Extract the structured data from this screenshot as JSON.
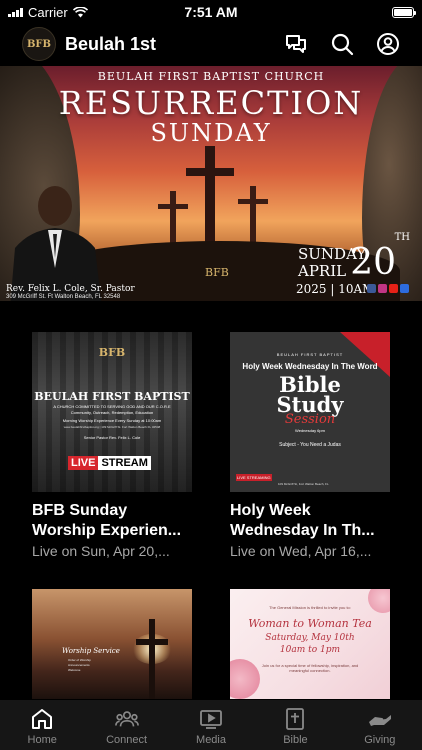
{
  "status_bar": {
    "carrier": "Carrier",
    "time": "7:51 AM"
  },
  "header": {
    "logo_text": "BFB",
    "title": "Beulah 1st"
  },
  "hero": {
    "church": "BEULAH FIRST BAPTIST CHURCH",
    "title_line1": "RESURRECTION",
    "title_line2": "SUNDAY",
    "pastor": "Rev. Felix L. Cole, Sr. Pastor",
    "address": "309 McGriff St. Ft Walton Beach, FL 32548",
    "date_weekday": "SUNDAY",
    "date_month": "APRIL",
    "date_day": "20",
    "date_suffix": "TH",
    "year_time": "2025 | 10AM",
    "watermark": "BFB",
    "slide_count": 5,
    "active_slide": 0
  },
  "cards": [
    {
      "thumb": {
        "logo": "BFB",
        "church": "BEULAH FIRST BAPTIST",
        "tagline": "A CHURCH COMMITTED TO SERVING GOD AND OUR C.O.R.E",
        "pillars": "Community, Outreach, Redemption, Education",
        "service": "Morning Worship Experience Every Sunday at 10:00am",
        "address": "www.beulahfirstbaptist.org | 109 McGriff St. Fort Walton Beach FL 32548",
        "pastor": "Senior Pastor Rev. Felix L. Cole",
        "live_badge_1": "LIVE",
        "live_badge_2": "STREAM"
      },
      "title": "BFB Sunday Worship Experien...",
      "subtitle": "Live on Sun, Apr 20,..."
    },
    {
      "thumb": {
        "header": "BEULAH FIRST BAPTIST",
        "line1": "Holy Week Wednesday In The Word",
        "big1": "Bible",
        "big2": "Study",
        "script": "Session",
        "when": "Wednesday 6pm",
        "subject": "Subject - You Need a Judas",
        "live": "LIVE STREAMING",
        "address": "109 McGriff St, Fort Walton Beach, FL"
      },
      "title": "Holy Week Wednesday In Th...",
      "subtitle": "Live on Wed, Apr 16,..."
    },
    {
      "thumb": {
        "heading": "Worship Service",
        "lines": [
          "Order of Worship",
          "Announcements",
          "Welcome"
        ]
      },
      "title": "",
      "subtitle": ""
    },
    {
      "thumb": {
        "intro": "The General Mission is thrilled to invite you to:",
        "title": "Woman to Woman Tea",
        "date": "Saturday, May 10th",
        "time": "10am to 1pm",
        "body": "Join us for a special time of fellowship, inspiration, and meaningful connection."
      },
      "title": "",
      "subtitle": ""
    }
  ],
  "tabs": [
    {
      "label": "Home",
      "icon": "home-icon",
      "active": true
    },
    {
      "label": "Connect",
      "icon": "people-icon",
      "active": false
    },
    {
      "label": "Media",
      "icon": "play-icon",
      "active": false
    },
    {
      "label": "Bible",
      "icon": "bible-icon",
      "active": false
    },
    {
      "label": "Giving",
      "icon": "giving-hand-icon",
      "active": false
    }
  ],
  "colors": {
    "background": "#000000",
    "tabbar": "#161616",
    "muted_text": "#a8a8a8",
    "gold": "#d7b56d",
    "live_red": "#d7262d"
  }
}
